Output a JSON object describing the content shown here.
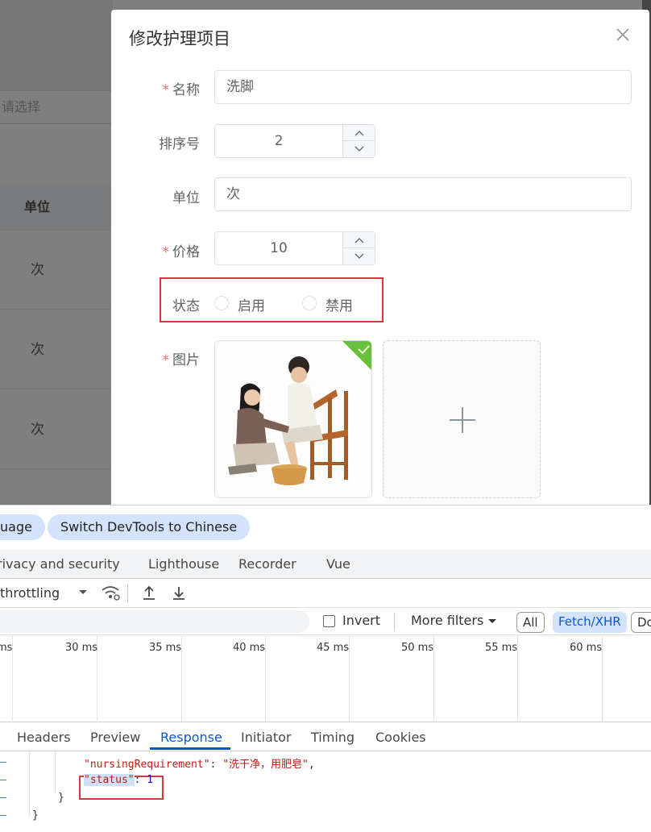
{
  "background": {
    "select_placeholder": "请选择",
    "table_header_unit": "单位",
    "rows": [
      "次",
      "次",
      "次"
    ]
  },
  "dialog": {
    "title": "修改护理项目",
    "fields": {
      "name": {
        "label": "名称",
        "value": "洗脚",
        "required": true
      },
      "order": {
        "label": "排序号",
        "value": "2"
      },
      "unit": {
        "label": "单位",
        "value": "次"
      },
      "price": {
        "label": "价格",
        "value": "10",
        "required": true
      },
      "status": {
        "label": "状态",
        "options": [
          "启用",
          "禁用"
        ],
        "selected": null
      },
      "image": {
        "label": "图片",
        "required": true
      }
    }
  },
  "devtools": {
    "lang_buttons": [
      "uage",
      "Switch DevTools to Chinese"
    ],
    "panel_tabs": [
      "rivacy and security",
      "Lighthouse",
      "Recorder",
      "Vue"
    ],
    "throttling": "throttling",
    "filter": {
      "invert": "Invert",
      "more_filters": "More filters",
      "chips": [
        "All",
        "Fetch/XHR",
        "Do"
      ],
      "active_chip": "Fetch/XHR"
    },
    "timeline_ticks": [
      "ms",
      "30 ms",
      "35 ms",
      "40 ms",
      "45 ms",
      "50 ms",
      "55 ms",
      "60 ms"
    ],
    "response_tabs": [
      "Headers",
      "Preview",
      "Response",
      "Initiator",
      "Timing",
      "Cookies"
    ],
    "active_response_tab": "Response",
    "code": {
      "line1_key": "\"nursingRequirement\"",
      "line1_value": "\"洗干净，用肥皂\"",
      "line2_key": "\"status\"",
      "line2_value": "1",
      "close_inner": "}",
      "close_outer": "}"
    }
  }
}
